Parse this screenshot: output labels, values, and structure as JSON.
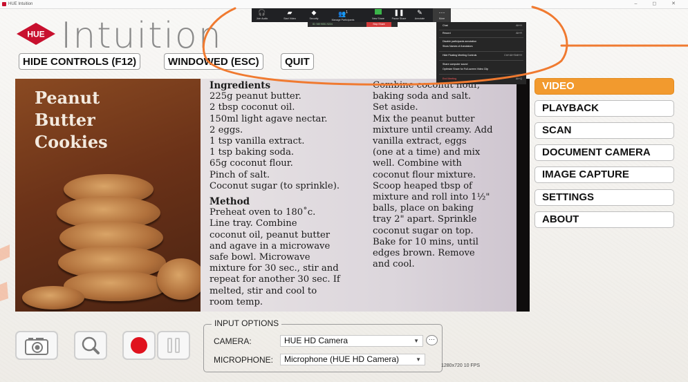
{
  "window": {
    "title": "HUE Intuition",
    "controls": "–  ◻  ✕"
  },
  "logo": {
    "badge": "HUE",
    "word": "Intuition"
  },
  "top_buttons": [
    "HIDE CONTROLS (F12)",
    "WINDOWED (ESC)",
    "QUIT"
  ],
  "document": {
    "bag_title": [
      "Peanut",
      "Butter",
      "Cookies"
    ],
    "col1": [
      {
        "t": "Ingredients",
        "style": "h"
      },
      {
        "t": "225g peanut butter."
      },
      {
        "t": "2 tbsp coconut oil."
      },
      {
        "t": "150ml light agave nectar."
      },
      {
        "t": "2 eggs."
      },
      {
        "t": "1 tsp vanilla extract."
      },
      {
        "t": "1 tsp baking soda."
      },
      {
        "t": "65g coconut flour."
      },
      {
        "t": "Pinch of salt."
      },
      {
        "t": "Coconut sugar (to sprinkle)."
      },
      {
        "t": "Method",
        "style": "m"
      },
      {
        "t": "Preheat oven to 180˚c."
      },
      {
        "t": "Line tray.  Combine"
      },
      {
        "t": "coconut oil, peanut butter"
      },
      {
        "t": "and agave in a microwave"
      },
      {
        "t": "safe bowl. Microwave"
      },
      {
        "t": "mixture for 30 sec., stir and"
      },
      {
        "t": "repeat for another 30 sec. If"
      },
      {
        "t": "melted, stir and cool to"
      },
      {
        "t": "room temp."
      }
    ],
    "col2": [
      "Combine coconut flour,",
      "baking soda and salt.",
      "Set aside.",
      "Mix the peanut butter",
      "mixture until creamy. Add",
      "vanilla extract, eggs",
      "(one at a time) and mix",
      "well. Combine with",
      "coconut flour mixture.",
      "Scoop heaped tbsp of",
      "mixture and roll into 1½\"",
      "balls, place on baking",
      "tray 2\" apart. Sprinkle",
      "coconut sugar on top.",
      "Bake for 10 mins, until",
      "edges brown. Remove",
      "and cool."
    ]
  },
  "menu": [
    {
      "label": "VIDEO",
      "active": true
    },
    {
      "label": "PLAYBACK"
    },
    {
      "label": "SCAN"
    },
    {
      "label": "DOCUMENT CAMERA"
    },
    {
      "label": "IMAGE CAPTURE"
    },
    {
      "label": "SETTINGS"
    },
    {
      "label": "ABOUT"
    }
  ],
  "input_options": {
    "legend": "INPUT OPTIONS",
    "camera_label": "CAMERA:",
    "camera_value": "HUE HD Camera",
    "mic_label": "MICROPHONE:",
    "mic_value": "Microphone (HUE HD Camera)",
    "more": "···",
    "resolution": "1280x720 10 FPS"
  },
  "bottom_icons": [
    "camera-icon",
    "magnifier-icon",
    "record-icon",
    "pause-icon"
  ],
  "zoom_toolbar": {
    "items": [
      "Join Audio",
      "Start Video",
      "Security",
      "Manage Participants",
      "New Share",
      "Pause Share",
      "Annotate",
      "More"
    ],
    "participants_count": "1",
    "meeting_id": "ID: 949 9051 9224",
    "stop_share": "Stop Share",
    "menu": [
      {
        "label": "Chat",
        "shortcut": "Alt+H"
      },
      {
        "label": "Record",
        "shortcut": "Alt+R"
      },
      {
        "label": "Disable participants annotation"
      },
      {
        "label": "Show Names of Annotators"
      },
      {
        "label": "Hide Floating Meeting Controls",
        "shortcut": "Ctrl+Alt+Shift+H"
      },
      {
        "label": "Share computer sound"
      },
      {
        "label": "Optimize Share for Full-screen Video Clip"
      },
      {
        "label": "End Meeting",
        "shortcut": "Alt+Q",
        "danger": true
      }
    ]
  },
  "colors": {
    "accent": "#f29a2e",
    "brand_red": "#c8102e",
    "annotation": "#f07a30",
    "record": "#e0121e"
  }
}
